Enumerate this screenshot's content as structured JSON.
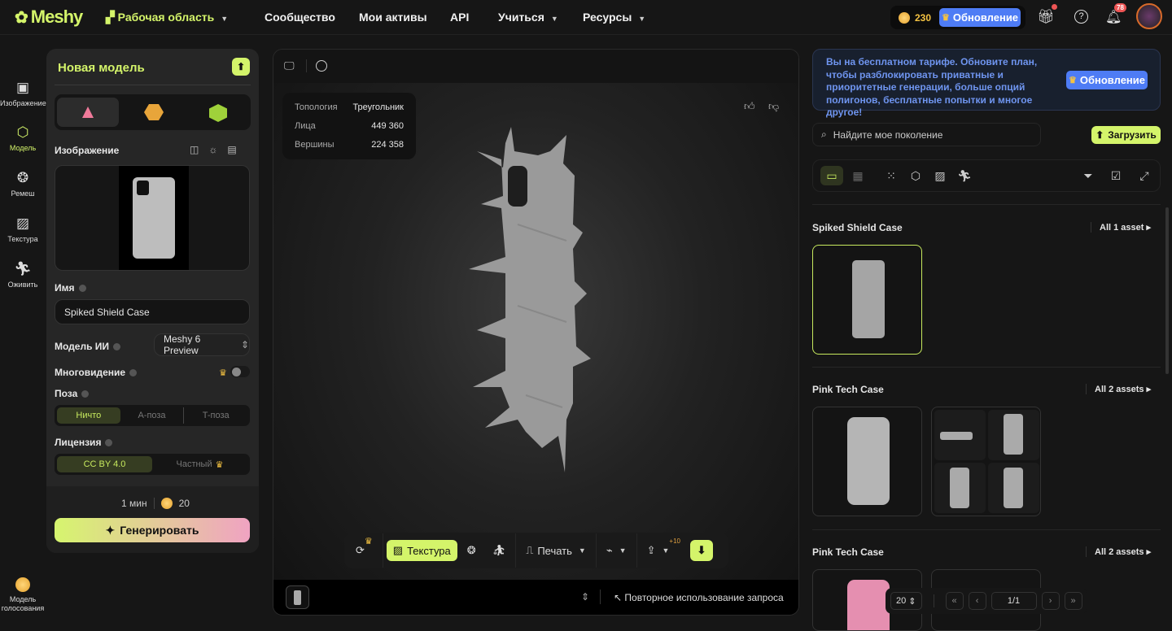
{
  "header": {
    "brand": "Meshy",
    "workspace": "Рабочая область",
    "nav": [
      "Сообщество",
      "Мои активы",
      "API",
      "Учиться",
      "Ресурсы"
    ],
    "credits": "230",
    "upgrade": "Обновление",
    "notifications": "78"
  },
  "rail": [
    {
      "label": "Изображение",
      "icon": "image-ai-icon"
    },
    {
      "label": "Модель",
      "icon": "cube-icon"
    },
    {
      "label": "Ремеш",
      "icon": "remesh-icon"
    },
    {
      "label": "Текстура",
      "icon": "texture-icon"
    },
    {
      "label": "Оживить",
      "icon": "animate-icon"
    }
  ],
  "rail_bottom": "Модель голосования",
  "panel": {
    "title": "Новая модель",
    "image_label": "Изображение",
    "name_label": "Имя",
    "name_value": "Spiked Shield Case",
    "ai_label": "Модель ИИ",
    "ai_value": "Meshy 6 Preview",
    "multiview_label": "Многовидение",
    "multiview_on": false,
    "pose_label": "Поза",
    "pose_options": [
      "Ничто",
      "A-поза",
      "T-поза"
    ],
    "pose_selected": 0,
    "license_label": "Лицензия",
    "license_options": [
      "CC BY 4.0",
      "Частный"
    ],
    "license_selected": 0,
    "time": "1 мин",
    "cost": "20",
    "generate": "Генерировать"
  },
  "viewer": {
    "stats": [
      {
        "k": "Топология",
        "v": "Треугольник"
      },
      {
        "k": "Лица",
        "v": "449 360"
      },
      {
        "k": "Вершины",
        "v": "224 358"
      }
    ],
    "texture_btn": "Текстура",
    "print_btn": "Печать",
    "share_badge": "+10",
    "reuse": "Повторное использование запроса"
  },
  "right": {
    "banner": "Вы на бесплатном тарифе. Обновите план, чтобы разблокировать приватные и приоритетные генерации, больше опций полигонов, бесплатные попытки и многое другое!",
    "banner_btn": "Обновление",
    "search_placeholder": "Найдите мое поколение",
    "upload": "Загрузить",
    "groups": [
      {
        "title": "Spiked Shield Case",
        "all": "All 1 asset"
      },
      {
        "title": "Pink Tech Case",
        "all": "All 2 assets"
      },
      {
        "title": "Pink Tech Case",
        "all": "All 2 assets"
      }
    ],
    "page_size": "20",
    "page": "1/1"
  },
  "colors": {
    "accent": "#d4f46a",
    "blue": "#4e7cf5",
    "bg": "#161616"
  }
}
